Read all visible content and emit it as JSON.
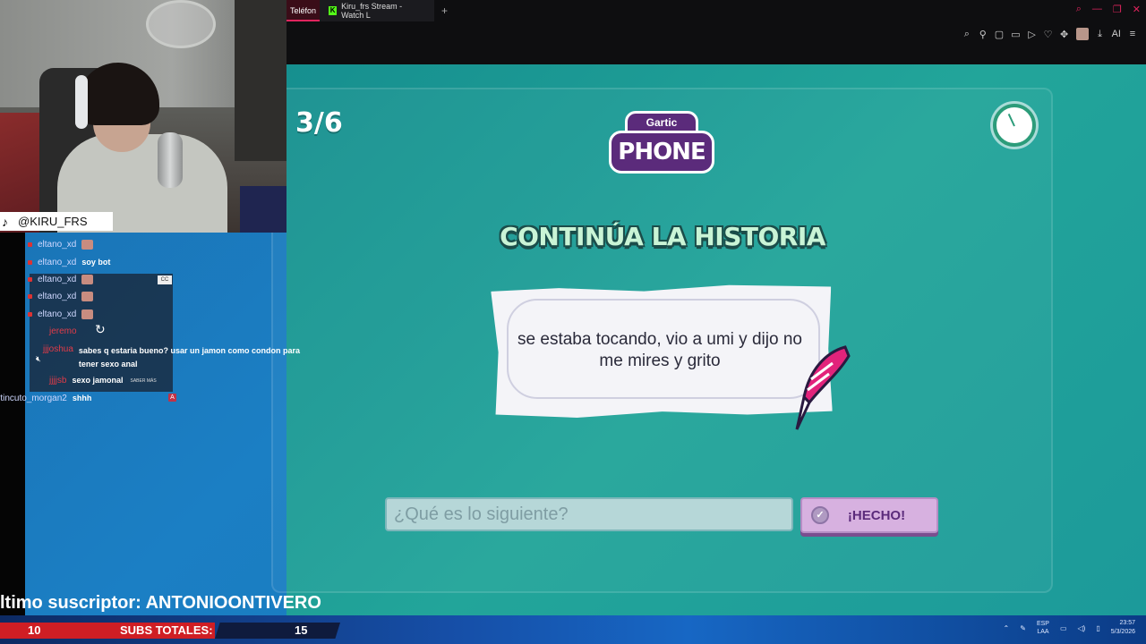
{
  "browser": {
    "tab_partial": "Teléfon",
    "tab_title": "Kiru_frs Stream - Watch L",
    "tab_favicon": "K",
    "new_tab": "+",
    "window_controls": [
      "⌕",
      "—",
      "❐",
      "✕"
    ],
    "toolbar_icons": [
      "zoom-icon",
      "pin-icon",
      "screenshot-icon",
      "cast-icon",
      "play-icon",
      "heart-icon",
      "extensions-icon",
      "avatar",
      "download-icon",
      "ai-icon",
      "menu-icon"
    ],
    "toolbar_ai_label": "AI"
  },
  "game": {
    "round": "3/6",
    "logo_top": "Gartic",
    "logo_main": "PHONE",
    "heading": "CONTINÚA LA HISTORIA",
    "story_text": "se estaba tocando, vio a umi y dijo no me mires y grito",
    "answer_placeholder": "¿Qué es lo siguiente?",
    "answer_value": "",
    "done_label": "¡HECHO!",
    "colors": {
      "accent": "#5b2b7b",
      "heading": "#c9f4d6",
      "bg": "#1e9c96"
    }
  },
  "stream": {
    "handle": "@KIRU_FRS",
    "chat": [
      {
        "user": "eltano_xd",
        "message": ""
      },
      {
        "user": "eltano_xd",
        "message": "soy bot"
      },
      {
        "user": "eltano_xd",
        "message": ""
      },
      {
        "user": "eltano_xd",
        "message": ""
      },
      {
        "user": "eltano_xd",
        "message": ""
      },
      {
        "user": "jeremo",
        "message": ""
      },
      {
        "user": "jjjoshua",
        "message": "sabes q estaria bueno? usar un jamon como condon para tener sexo anal"
      },
      {
        "user": "jjjjsb",
        "message": "sexo jamonal",
        "more": "SABER MÁS"
      },
      {
        "user": "rtincuto_morgan2",
        "message": "shhh"
      }
    ],
    "last_subscriber": "ltimo suscriptor: ANTONIOONTIVERO",
    "subs_label": "SUBS TOTALES:",
    "subs_current": "10",
    "subs_goal": "15"
  },
  "taskbar": {
    "lang_top": "ESP",
    "lang_bottom": "LAA",
    "time": "23:57",
    "date": "5/3/2026"
  }
}
